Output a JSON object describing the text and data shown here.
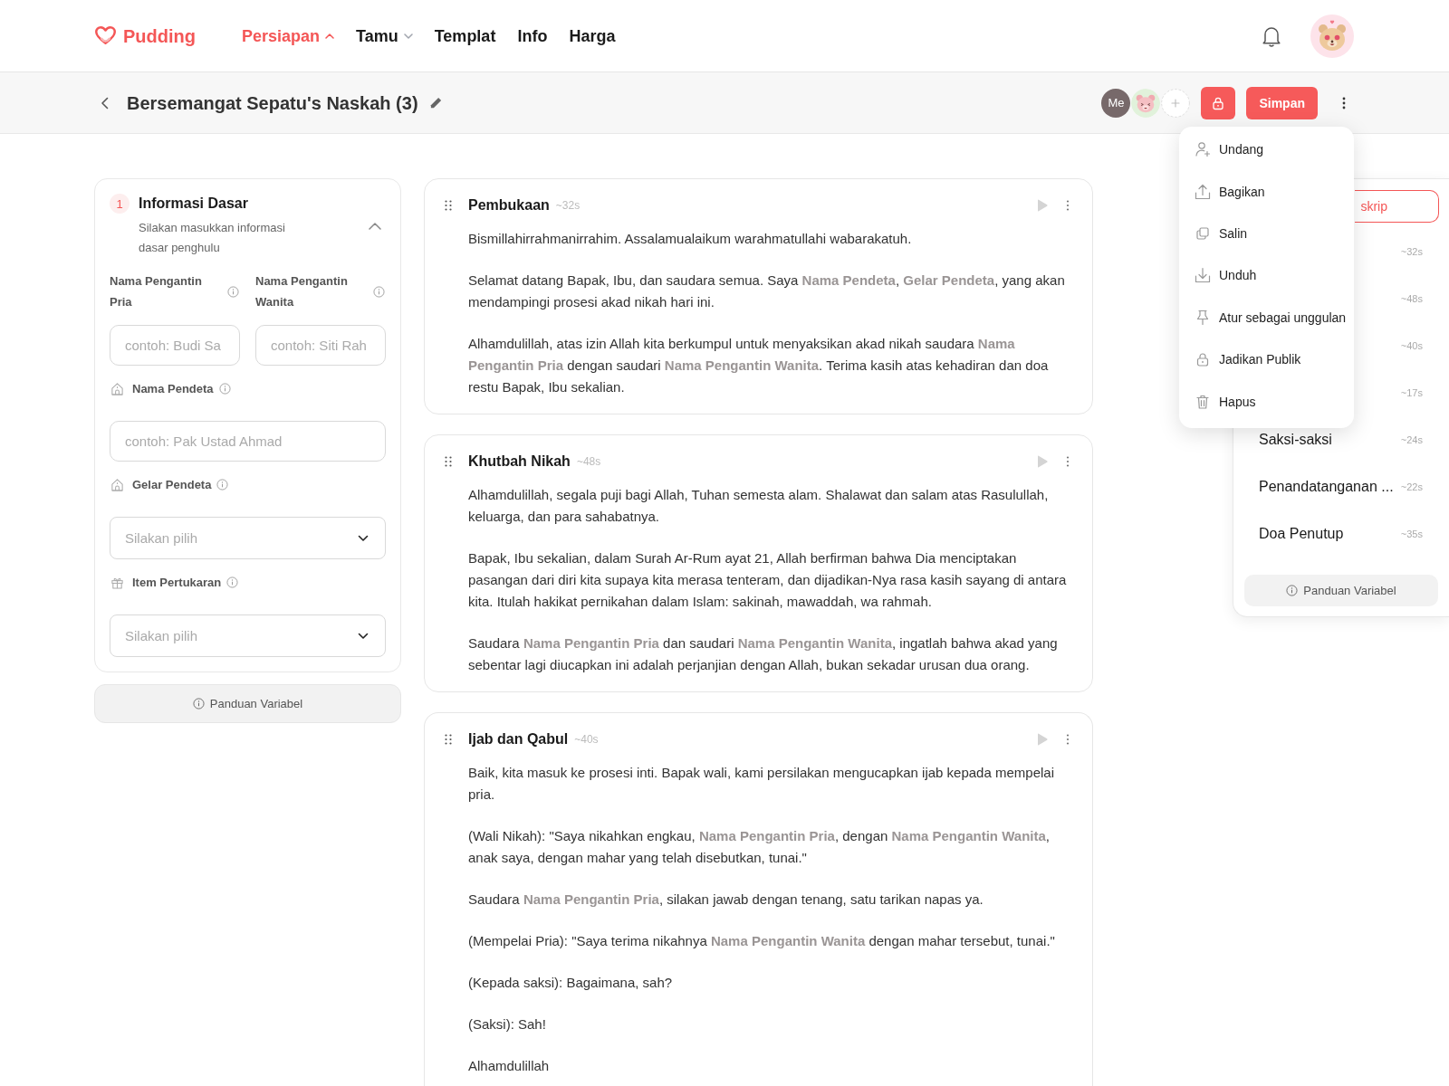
{
  "header": {
    "logo": "Pudding",
    "nav": [
      {
        "label": "Persiapan",
        "selected": true,
        "dropdown": true,
        "expanded": true
      },
      {
        "label": "Tamu",
        "selected": false,
        "dropdown": true,
        "expanded": false
      },
      {
        "label": "Templat",
        "selected": false,
        "dropdown": false
      },
      {
        "label": "Info",
        "selected": false,
        "dropdown": false
      },
      {
        "label": "Harga",
        "selected": false,
        "dropdown": false
      }
    ]
  },
  "toolbar": {
    "title": "Bersemangat Sepatu's Naskah (3)",
    "collaborators": [
      {
        "kind": "initials",
        "text": "Me"
      },
      {
        "kind": "picture"
      }
    ],
    "save": "Simpan"
  },
  "menu": {
    "items": [
      "Undang",
      "Bagikan",
      "Salin",
      "Unduh",
      "Atur sebagai unggulan",
      "Jadikan Publik",
      "Hapus"
    ]
  },
  "form": {
    "step": "1",
    "title": "Informasi Dasar",
    "subtitle": "Silakan masukkan informasi dasar penghulu",
    "expanded": true,
    "fields": [
      {
        "kind": "pair",
        "items": [
          {
            "label": "Nama Pengantin Pria",
            "placeholder": "contoh: Budi Sa"
          },
          {
            "label": "Nama Pengantin Wanita",
            "placeholder": "contoh: Siti Rah"
          }
        ]
      },
      {
        "kind": "text",
        "label": "Nama Pendeta",
        "placeholder": "contoh: Pak Ustad Ahmad"
      },
      {
        "kind": "select",
        "label": "Gelar Pendeta",
        "placeholder": "Silakan pilih"
      },
      {
        "kind": "select",
        "label": "Item Pertukaran",
        "placeholder": "Silakan pilih"
      }
    ],
    "guide": "Panduan Variabel"
  },
  "sections": [
    {
      "title": "Pembukaan",
      "duration": "~32s",
      "paragraphs": [
        "Bismillahirrahmanirrahim. Assalamualaikum warahmatullahi wabarakatuh.",
        "Selamat datang Bapak, Ibu, dan saudara semua. Saya **Nama Pendeta**, **Gelar Pendeta**, yang akan mendampingi prosesi akad nikah hari ini.",
        "Alhamdulillah, atas izin Allah kita berkumpul untuk menyaksikan akad nikah saudara **Nama Pengantin Pria** dengan saudari **Nama Pengantin Wanita**. Terima kasih atas kehadiran dan doa restu Bapak, Ibu sekalian."
      ]
    },
    {
      "title": "Khutbah Nikah",
      "duration": "~48s",
      "paragraphs": [
        "Alhamdulillah, segala puji bagi Allah, Tuhan semesta alam. Shalawat dan salam atas Rasulullah, keluarga, dan para sahabatnya.",
        "Bapak, Ibu sekalian, dalam Surah Ar-Rum ayat 21, Allah berfirman bahwa Dia menciptakan pasangan dari diri kita supaya kita merasa tenteram, dan dijadikan-Nya rasa kasih sayang di antara kita. Itulah hakikat pernikahan dalam Islam: sakinah, mawaddah, wa rahmah.",
        "Saudara **Nama Pengantin Pria** dan saudari **Nama Pengantin Wanita**, ingatlah bahwa akad yang sebentar lagi diucapkan ini adalah perjanjian dengan Allah, bukan sekadar urusan dua orang."
      ]
    },
    {
      "title": "Ijab dan Qabul",
      "duration": "~40s",
      "paragraphs": [
        "Baik, kita masuk ke prosesi inti. Bapak wali, kami persilakan mengucapkan ijab kepada mempelai pria.",
        "(Wali Nikah): \"Saya nikahkan engkau, **Nama Pengantin Pria**, dengan **Nama Pengantin Wanita**, anak saya, dengan mahar yang telah disebutkan, tunai.\"",
        "Saudara **Nama Pengantin Pria**, silakan jawab dengan tenang, satu tarikan napas ya.",
        "(Mempelai Pria): \"Saya terima nikahnya **Nama Pengantin Wanita** dengan mahar tersebut, tunai.\"",
        "(Kepada saksi): Bagaimana, sah?",
        "(Saksi): Sah!",
        "Alhamdulillah"
      ]
    }
  ],
  "outline": {
    "button": "skrip",
    "items": [
      {
        "duration": "~32s"
      },
      {
        "duration": "~48s"
      },
      {
        "duration": "~40s"
      },
      {
        "duration": "~17s"
      },
      {
        "title": "Saksi-saksi",
        "duration": "~24s"
      },
      {
        "title": "Penandatanganan ...",
        "duration": "~22s"
      },
      {
        "title": "Doa Penutup",
        "duration": "~35s"
      }
    ],
    "guide": "Panduan Variabel"
  }
}
